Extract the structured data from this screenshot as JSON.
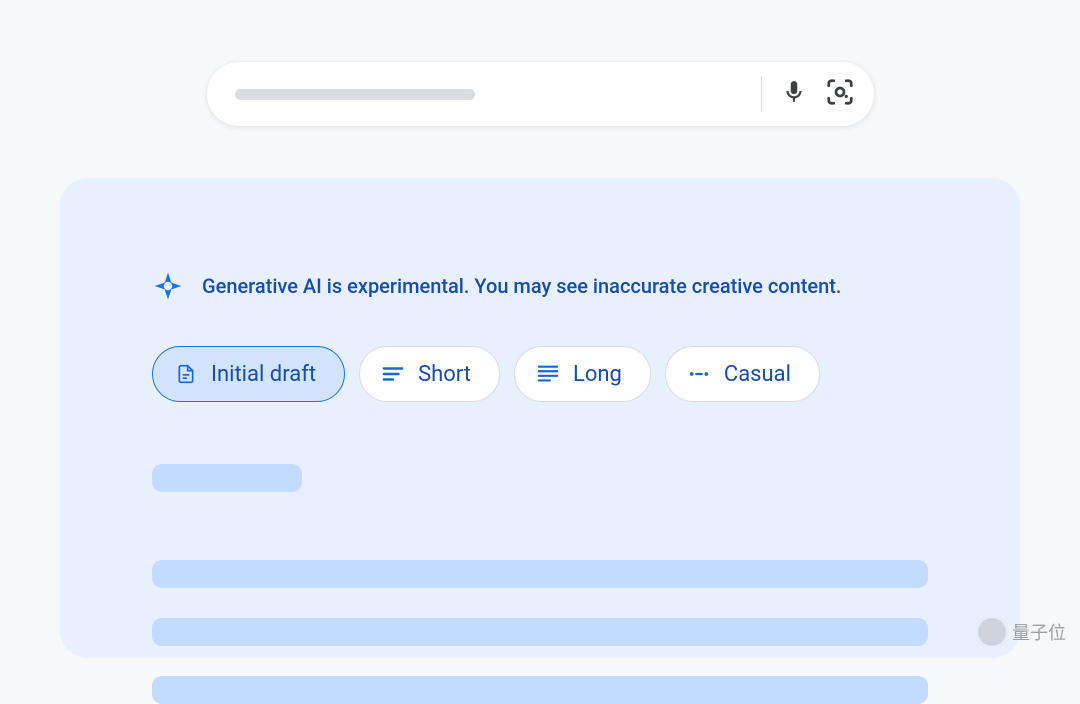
{
  "search": {
    "placeholder": ""
  },
  "card": {
    "disclaimer": "Generative AI is experimental. You may see inaccurate creative content.",
    "chips": {
      "initial_draft": "Initial draft",
      "short": "Short",
      "long": "Long",
      "casual": "Casual"
    }
  },
  "watermark": {
    "label": "量子位"
  }
}
